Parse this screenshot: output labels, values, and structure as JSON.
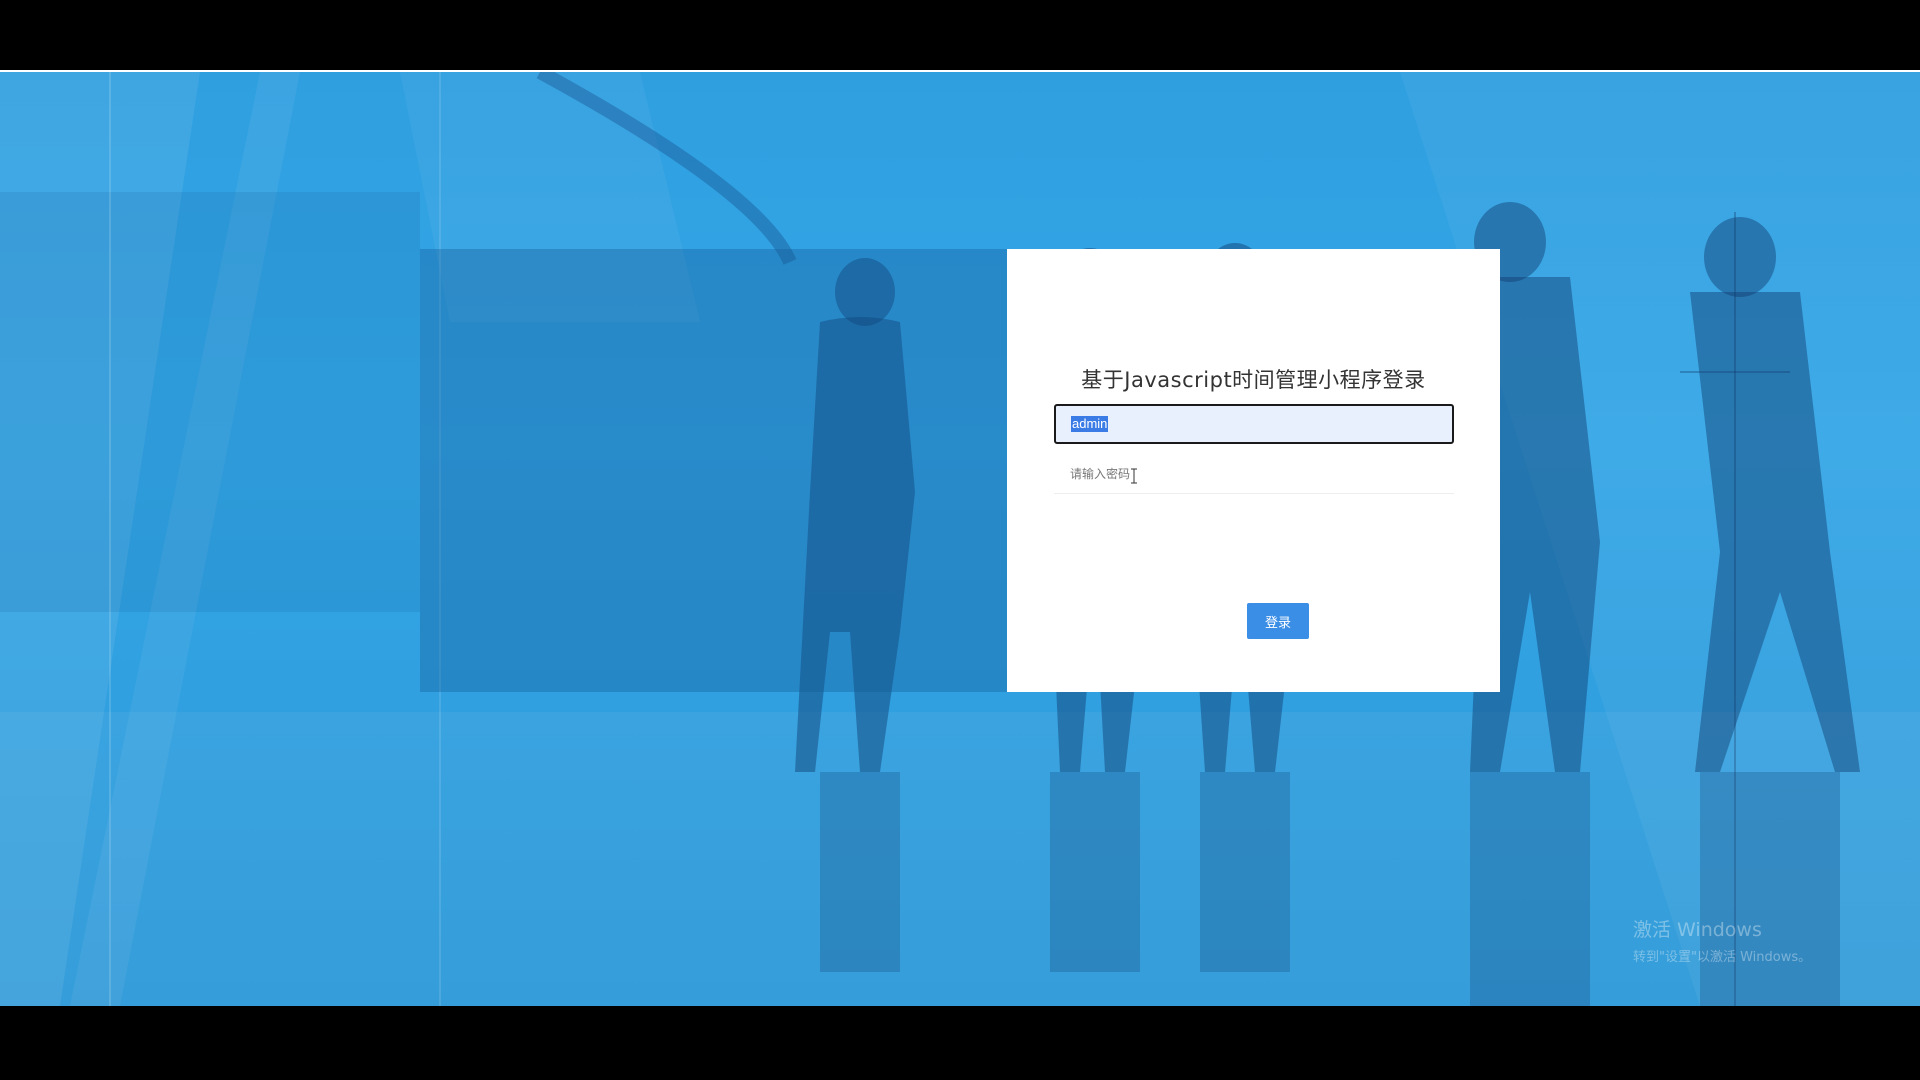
{
  "login": {
    "title": "基于Javascript时间管理小程序登录",
    "username_value": "admin",
    "password_placeholder": "请输入密码",
    "submit_label": "登录"
  },
  "watermark": {
    "title": "激活 Windows",
    "subtitle": "转到\"设置\"以激活 Windows。"
  },
  "colors": {
    "background_blue": "#34a6e6",
    "button_blue": "#3a8ee6",
    "card": "#ffffff"
  }
}
